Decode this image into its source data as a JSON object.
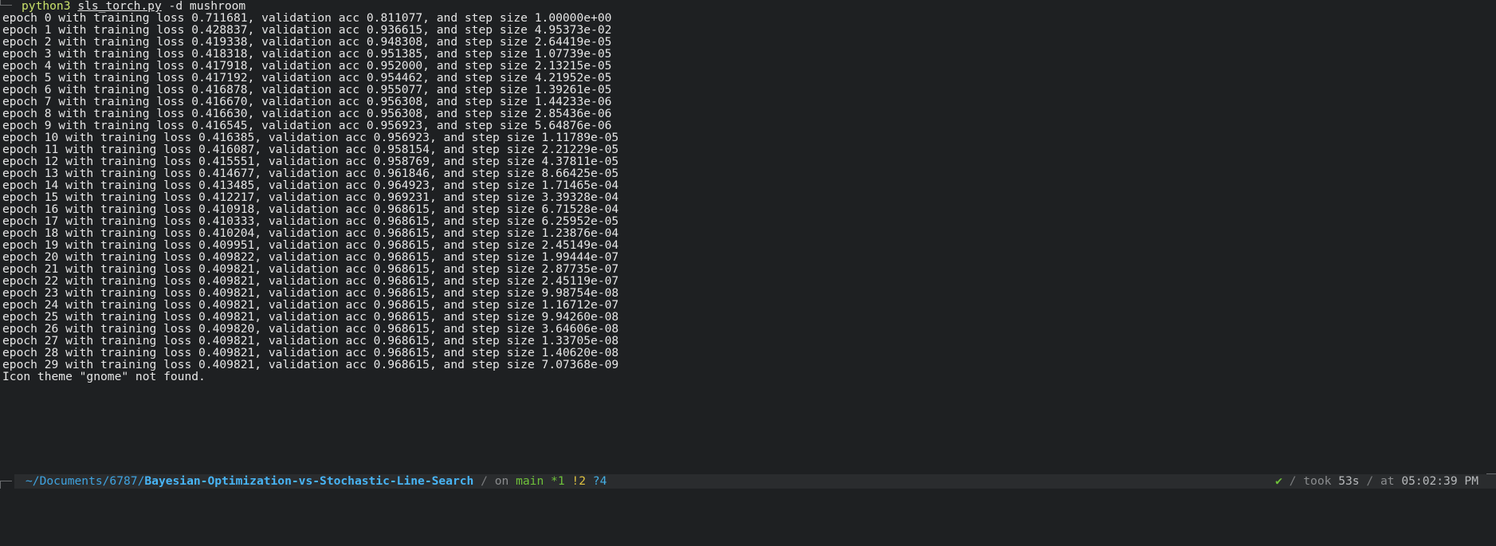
{
  "command": {
    "program": "python3",
    "file": "sls_torch.py",
    "args": "-d mushroom"
  },
  "output_lines": [
    "epoch 0 with training loss 0.711681, validation acc 0.811077, and step size 1.00000e+00",
    "epoch 1 with training loss 0.428837, validation acc 0.936615, and step size 4.95373e-02",
    "epoch 2 with training loss 0.419338, validation acc 0.948308, and step size 2.64419e-05",
    "epoch 3 with training loss 0.418318, validation acc 0.951385, and step size 1.07739e-05",
    "epoch 4 with training loss 0.417918, validation acc 0.952000, and step size 2.13215e-05",
    "epoch 5 with training loss 0.417192, validation acc 0.954462, and step size 4.21952e-05",
    "epoch 6 with training loss 0.416878, validation acc 0.955077, and step size 1.39261e-05",
    "epoch 7 with training loss 0.416670, validation acc 0.956308, and step size 1.44233e-06",
    "epoch 8 with training loss 0.416630, validation acc 0.956308, and step size 2.85436e-06",
    "epoch 9 with training loss 0.416545, validation acc 0.956923, and step size 5.64876e-06",
    "epoch 10 with training loss 0.416385, validation acc 0.956923, and step size 1.11789e-05",
    "epoch 11 with training loss 0.416087, validation acc 0.958154, and step size 2.21229e-05",
    "epoch 12 with training loss 0.415551, validation acc 0.958769, and step size 4.37811e-05",
    "epoch 13 with training loss 0.414677, validation acc 0.961846, and step size 8.66425e-05",
    "epoch 14 with training loss 0.413485, validation acc 0.964923, and step size 1.71465e-04",
    "epoch 15 with training loss 0.412217, validation acc 0.969231, and step size 3.39328e-04",
    "epoch 16 with training loss 0.410918, validation acc 0.968615, and step size 6.71528e-04",
    "epoch 17 with training loss 0.410333, validation acc 0.968615, and step size 6.25952e-05",
    "epoch 18 with training loss 0.410204, validation acc 0.968615, and step size 1.23876e-04",
    "epoch 19 with training loss 0.409951, validation acc 0.968615, and step size 2.45149e-04",
    "epoch 20 with training loss 0.409822, validation acc 0.968615, and step size 1.99444e-07",
    "epoch 21 with training loss 0.409821, validation acc 0.968615, and step size 2.87735e-07",
    "epoch 22 with training loss 0.409821, validation acc 0.968615, and step size 2.45119e-07",
    "epoch 23 with training loss 0.409821, validation acc 0.968615, and step size 9.98754e-08",
    "epoch 24 with training loss 0.409821, validation acc 0.968615, and step size 1.16712e-07",
    "epoch 25 with training loss 0.409821, validation acc 0.968615, and step size 9.94260e-08",
    "epoch 26 with training loss 0.409820, validation acc 0.968615, and step size 3.64606e-08",
    "epoch 27 with training loss 0.409821, validation acc 0.968615, and step size 1.33705e-08",
    "epoch 28 with training loss 0.409821, validation acc 0.968615, and step size 1.40620e-08",
    "epoch 29 with training loss 0.409821, validation acc 0.968615, and step size 7.07368e-09",
    "Icon theme \"gnome\" not found."
  ],
  "prompt": {
    "path_prefix": "~/Documents/6787/",
    "path_dir": "Bayesian-Optimization-vs-Stochastic-Line-Search",
    "separator": "/",
    "on_label": "on",
    "branch": "main",
    "staged": "*1",
    "modified": "!2",
    "untracked": "?4",
    "status_ok": "✔",
    "took_label": "took",
    "duration": "53s",
    "at_label": "at",
    "time": "05:02:39 PM"
  },
  "colors": {
    "background": "#1e2022",
    "foreground": "#e6e6e6",
    "path": "#48b4f5",
    "branch": "#6fc23a",
    "modified": "#e0c341",
    "untracked": "#45b0e5"
  }
}
